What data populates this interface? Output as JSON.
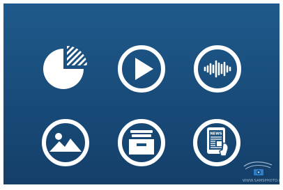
{
  "background": {
    "top_color": "#1f5a8c",
    "bottom_color": "#143f69"
  },
  "icon_color": "#ffffff",
  "icons": [
    {
      "name": "pie-chart-icon"
    },
    {
      "name": "play-icon"
    },
    {
      "name": "audio-waveform-icon"
    },
    {
      "name": "image-icon"
    },
    {
      "name": "archive-box-icon"
    },
    {
      "name": "news-tablet-icon"
    }
  ],
  "newspaper_label": "NEWS",
  "watermark": {
    "icon": "camera-wing-icon",
    "text": "WWW.SAMSPHOTO.KR"
  }
}
